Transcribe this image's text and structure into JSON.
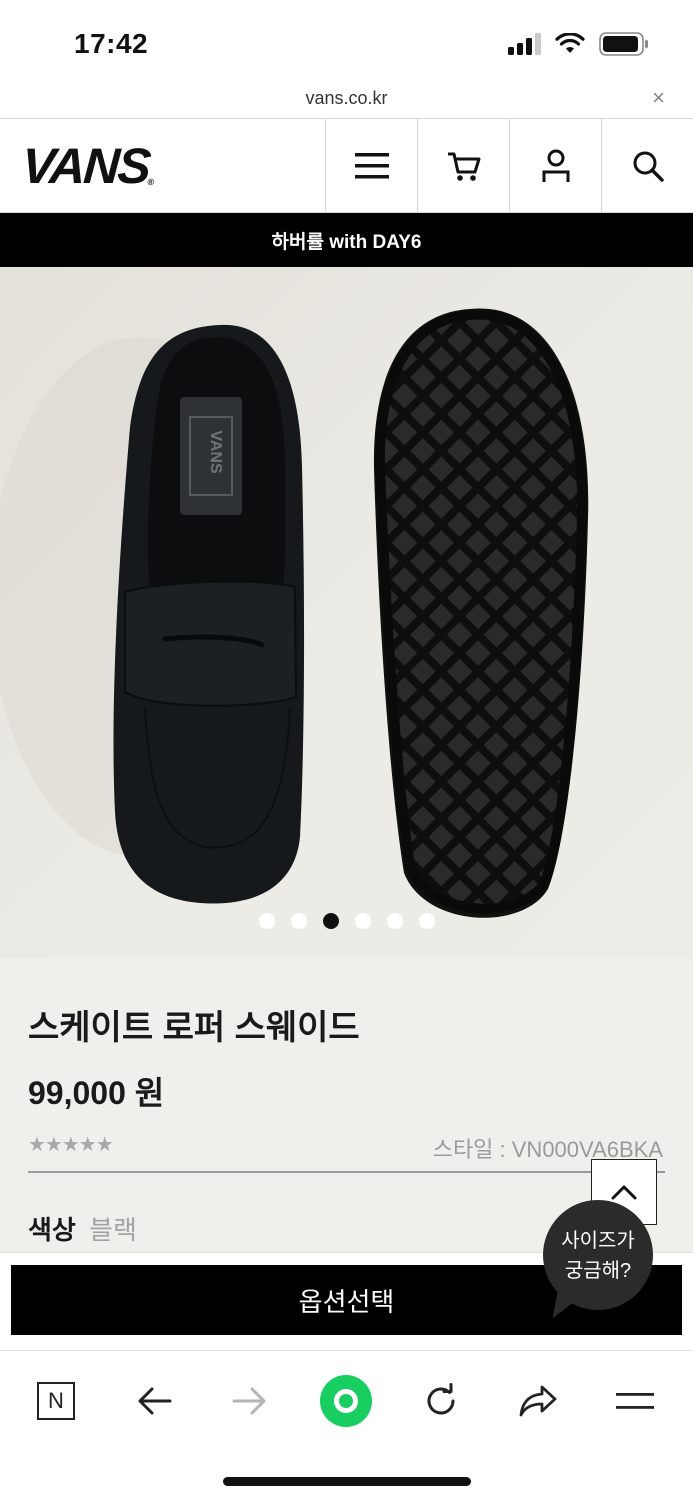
{
  "status_bar": {
    "time": "17:42"
  },
  "browser": {
    "url": "vans.co.kr",
    "close_label": "×"
  },
  "header": {
    "logo_text": "VANS",
    "logo_tm": "®"
  },
  "promo": {
    "text": "하버률 with DAY6"
  },
  "gallery": {
    "dot_count": 6,
    "active_index": 2
  },
  "product": {
    "name": "스케이트 로퍼 스웨이드",
    "price": "99,000 원",
    "rating_stars": "★★★★★",
    "style_label": "스타일 : VN000VA6BKA",
    "color_label": "색상",
    "color_value": "블랙",
    "cta_label": "옵션선택"
  },
  "size_helper": {
    "line1": "사이즈가",
    "line2": "궁금해?"
  },
  "toolbar": {
    "naver_label": "N"
  },
  "colors": {
    "accent_green": "#19ce60",
    "black": "#000000",
    "panel": "#efefeb"
  }
}
